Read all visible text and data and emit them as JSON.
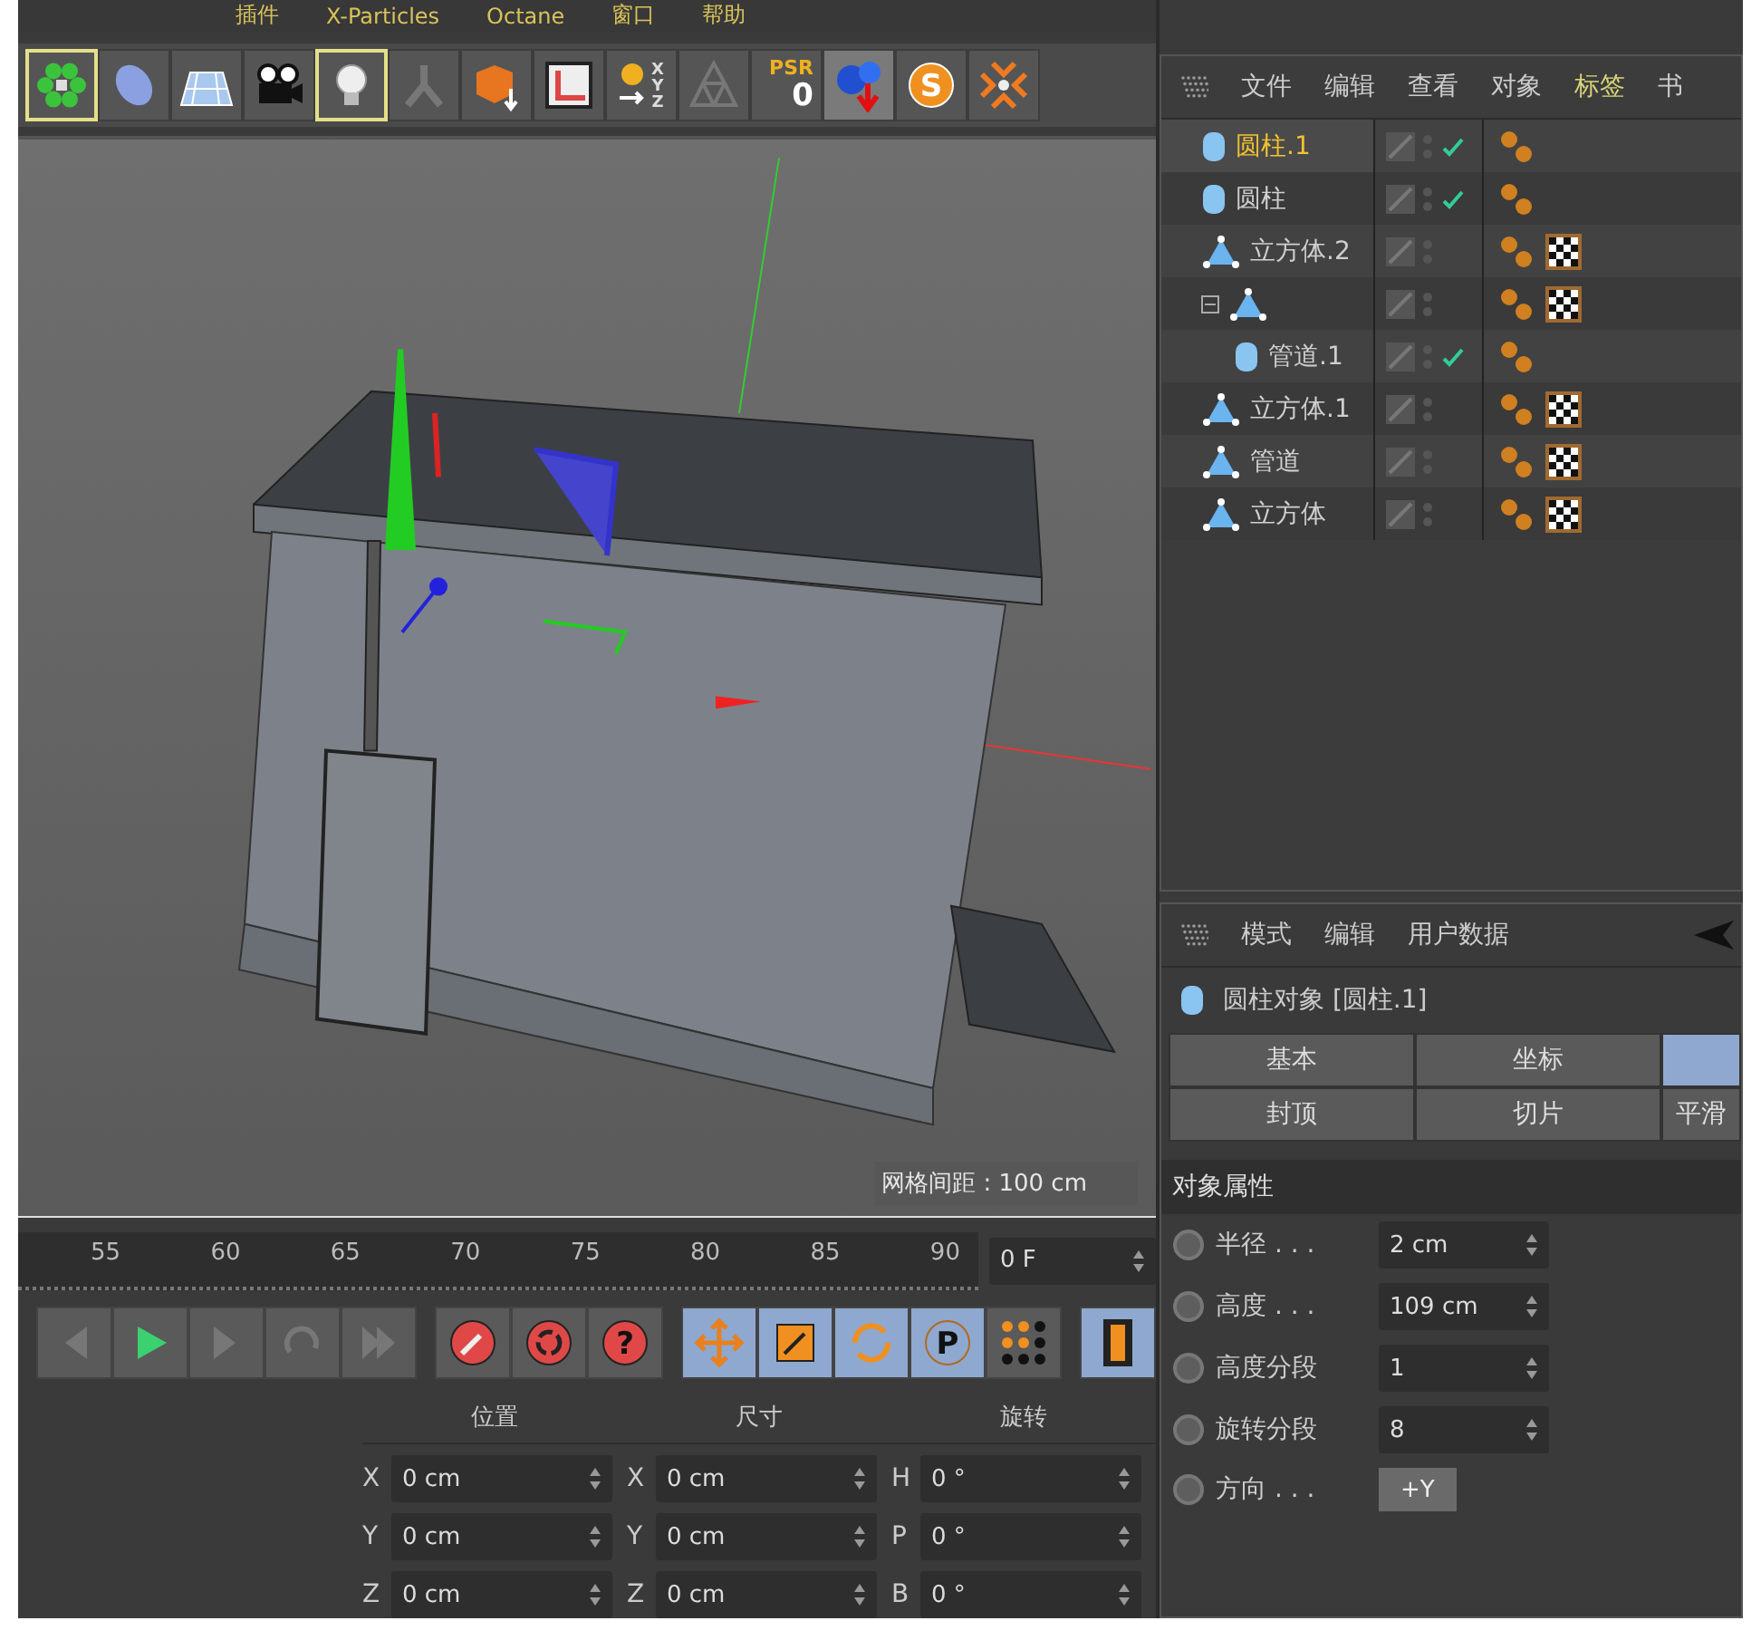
{
  "menu_bar": [
    "插件",
    "X-Particles",
    "Octane",
    "窗口",
    "帮助"
  ],
  "toolbar": [
    {
      "kind": "flower",
      "highlighted": true
    },
    {
      "kind": "blob",
      "highlighted": false
    },
    {
      "kind": "grid",
      "highlighted": false
    },
    {
      "kind": "camera",
      "highlighted": false
    },
    {
      "kind": "bulb",
      "highlighted": true
    },
    {
      "kind": "joint",
      "highlighted": false
    },
    {
      "kind": "boxarrow",
      "highlighted": false
    },
    {
      "kind": "frame",
      "highlighted": false
    },
    {
      "kind": "xyz",
      "highlighted": false,
      "letters": [
        "X",
        "Y",
        "Z"
      ]
    },
    {
      "kind": "triangles",
      "highlighted": false
    },
    {
      "kind": "psr",
      "highlighted": false,
      "label": "PSR",
      "value": "0"
    },
    {
      "kind": "spheres",
      "highlighted": false
    },
    {
      "kind": "sbadge",
      "highlighted": false,
      "label": "S"
    },
    {
      "kind": "snap",
      "highlighted": false
    }
  ],
  "viewport": {
    "grid_label": "网格间距 : 100 cm"
  },
  "timeline": {
    "ticks": [
      "55",
      "60",
      "65",
      "70",
      "75",
      "80",
      "85",
      "90"
    ],
    "frame": "0 F"
  },
  "transport": [
    {
      "kind": "prev"
    },
    {
      "kind": "play"
    },
    {
      "kind": "next"
    },
    {
      "kind": "loop"
    },
    {
      "kind": "end"
    }
  ],
  "tools": [
    {
      "kind": "wrench",
      "active": false
    },
    {
      "kind": "cycle",
      "active": false
    },
    {
      "kind": "help",
      "active": false,
      "label": "?"
    },
    {
      "kind": "move",
      "active": true
    },
    {
      "kind": "scale",
      "active": true
    },
    {
      "kind": "rotate",
      "active": true
    },
    {
      "kind": "pbadge",
      "active": true,
      "label": "P"
    },
    {
      "kind": "dots",
      "active": false
    },
    {
      "kind": "film",
      "active": true
    }
  ],
  "coordinates": {
    "columns": [
      "位置",
      "尺寸",
      "旋转"
    ],
    "rows": [
      [
        {
          "axis": "X",
          "value": "0 cm"
        },
        {
          "axis": "X",
          "value": "0 cm"
        },
        {
          "axis": "H",
          "value": "0 °"
        }
      ],
      [
        {
          "axis": "Y",
          "value": "0 cm"
        },
        {
          "axis": "Y",
          "value": "0 cm"
        },
        {
          "axis": "P",
          "value": "0 °"
        }
      ],
      [
        {
          "axis": "Z",
          "value": "0 cm"
        },
        {
          "axis": "Z",
          "value": "0 cm"
        },
        {
          "axis": "B",
          "value": "0 °"
        }
      ]
    ]
  },
  "object_manager": {
    "menu": [
      {
        "label": "文件",
        "highlighted": false
      },
      {
        "label": "编辑",
        "highlighted": false
      },
      {
        "label": "查看",
        "highlighted": false
      },
      {
        "label": "对象",
        "highlighted": false
      },
      {
        "label": "标签",
        "highlighted": true
      },
      {
        "label": "书",
        "highlighted": false
      }
    ],
    "objects": [
      {
        "name": "圆柱.1",
        "kind": "cylinder",
        "selected": true,
        "checked": true,
        "texture_tag": false
      },
      {
        "name": "圆柱",
        "kind": "cylinder",
        "selected": false,
        "checked": true,
        "texture_tag": false
      },
      {
        "name": "立方体.2",
        "kind": "cube",
        "selected": false,
        "checked": false,
        "texture_tag": true
      },
      {
        "kind": "cube",
        "selected": false,
        "checked": false,
        "texture_tag": true,
        "expanded": true,
        "children": [
          {
            "name": "管道.1",
            "kind": "cylinder",
            "selected": false,
            "checked": true,
            "texture_tag": false
          }
        ]
      },
      {
        "name": "立方体.1",
        "kind": "cube",
        "selected": false,
        "checked": false,
        "texture_tag": true
      },
      {
        "name": "管道",
        "kind": "cube",
        "selected": false,
        "checked": false,
        "texture_tag": true
      },
      {
        "name": "立方体",
        "kind": "cube",
        "selected": false,
        "checked": false,
        "texture_tag": true
      }
    ]
  },
  "attributes": {
    "menu": [
      "模式",
      "编辑",
      "用户数据"
    ],
    "title": "圆柱对象 [圆柱.1]",
    "tab_rows": [
      [
        {
          "label": "基本",
          "selected": false
        },
        {
          "label": "坐标",
          "selected": false
        },
        {
          "selected": true
        }
      ],
      [
        {
          "label": "封顶",
          "selected": false
        },
        {
          "label": "切片",
          "selected": false
        },
        {
          "label": "平滑",
          "selected": false
        }
      ]
    ],
    "section": "对象属性",
    "fields": [
      {
        "label": "半径 . . .",
        "value": "2 cm",
        "kind": "number"
      },
      {
        "label": "高度 . . .",
        "value": "109 cm",
        "kind": "number"
      },
      {
        "label": "高度分段",
        "value": "1",
        "kind": "number"
      },
      {
        "label": "旋转分段",
        "value": "8",
        "kind": "number"
      },
      {
        "label": "方向 . . .",
        "value": "+Y",
        "kind": "dropdown"
      }
    ]
  }
}
